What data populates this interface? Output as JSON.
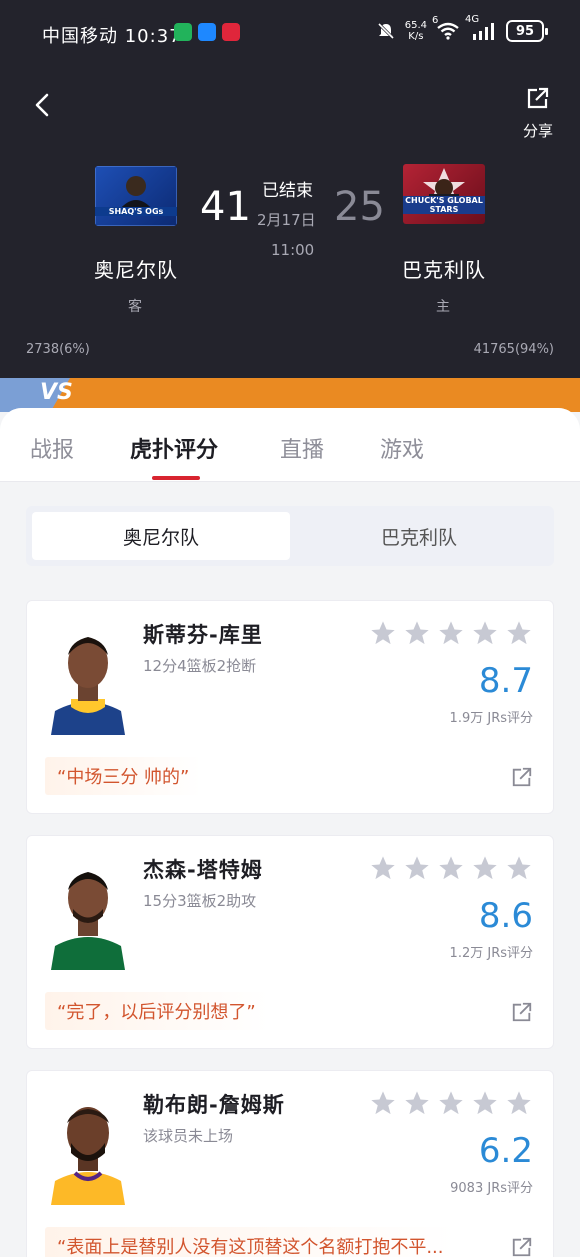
{
  "status_bar": {
    "carrier_time": "中国移动 10:37",
    "net_speed_value": "65.4",
    "net_speed_unit": "K/s",
    "wifi_badge": "6",
    "signal_badge": "4G",
    "battery": "95"
  },
  "header": {
    "share_label": "分享"
  },
  "match": {
    "status": "已结束",
    "date": "2月17日",
    "time": "11:00",
    "away": {
      "name": "奥尼尔队",
      "role": "客",
      "score": "41",
      "logo_text": "SHAQ'S OGs",
      "votes": "2738(6%)"
    },
    "home": {
      "name": "巴克利队",
      "role": "主",
      "score": "25",
      "logo_text": "CHUCK'S GLOBAL STARS",
      "votes": "41765(94%)"
    },
    "vs_label": "VS"
  },
  "tabs": [
    {
      "label": "战报"
    },
    {
      "label": "虎扑评分"
    },
    {
      "label": "直播"
    },
    {
      "label": "游戏"
    }
  ],
  "team_toggle": {
    "selected": "奥尼尔队",
    "other": "巴克利队"
  },
  "players": [
    {
      "name": "斯蒂芬-库里",
      "stats": "12分4篮板2抢断",
      "rating": "8.7",
      "votes": "1.9万 JRs评分",
      "comment": "“中场三分 帅的”"
    },
    {
      "name": "杰森-塔特姆",
      "stats": "15分3篮板2助攻",
      "rating": "8.6",
      "votes": "1.2万 JRs评分",
      "comment": "“完了，以后评分别想了”"
    },
    {
      "name": "勒布朗-詹姆斯",
      "stats": "该球员未上场",
      "rating": "6.2",
      "votes": "9083 JRs评分",
      "comment": "“表面上是替别人没有这顶替这个名额打抱不平..."
    }
  ],
  "colors": {
    "header_bg": "#23232c",
    "accent_red": "#d8242f",
    "rating_blue": "#2b8ad6",
    "comment_orange": "#d2552e",
    "vs_orange": "#ea8a22"
  }
}
